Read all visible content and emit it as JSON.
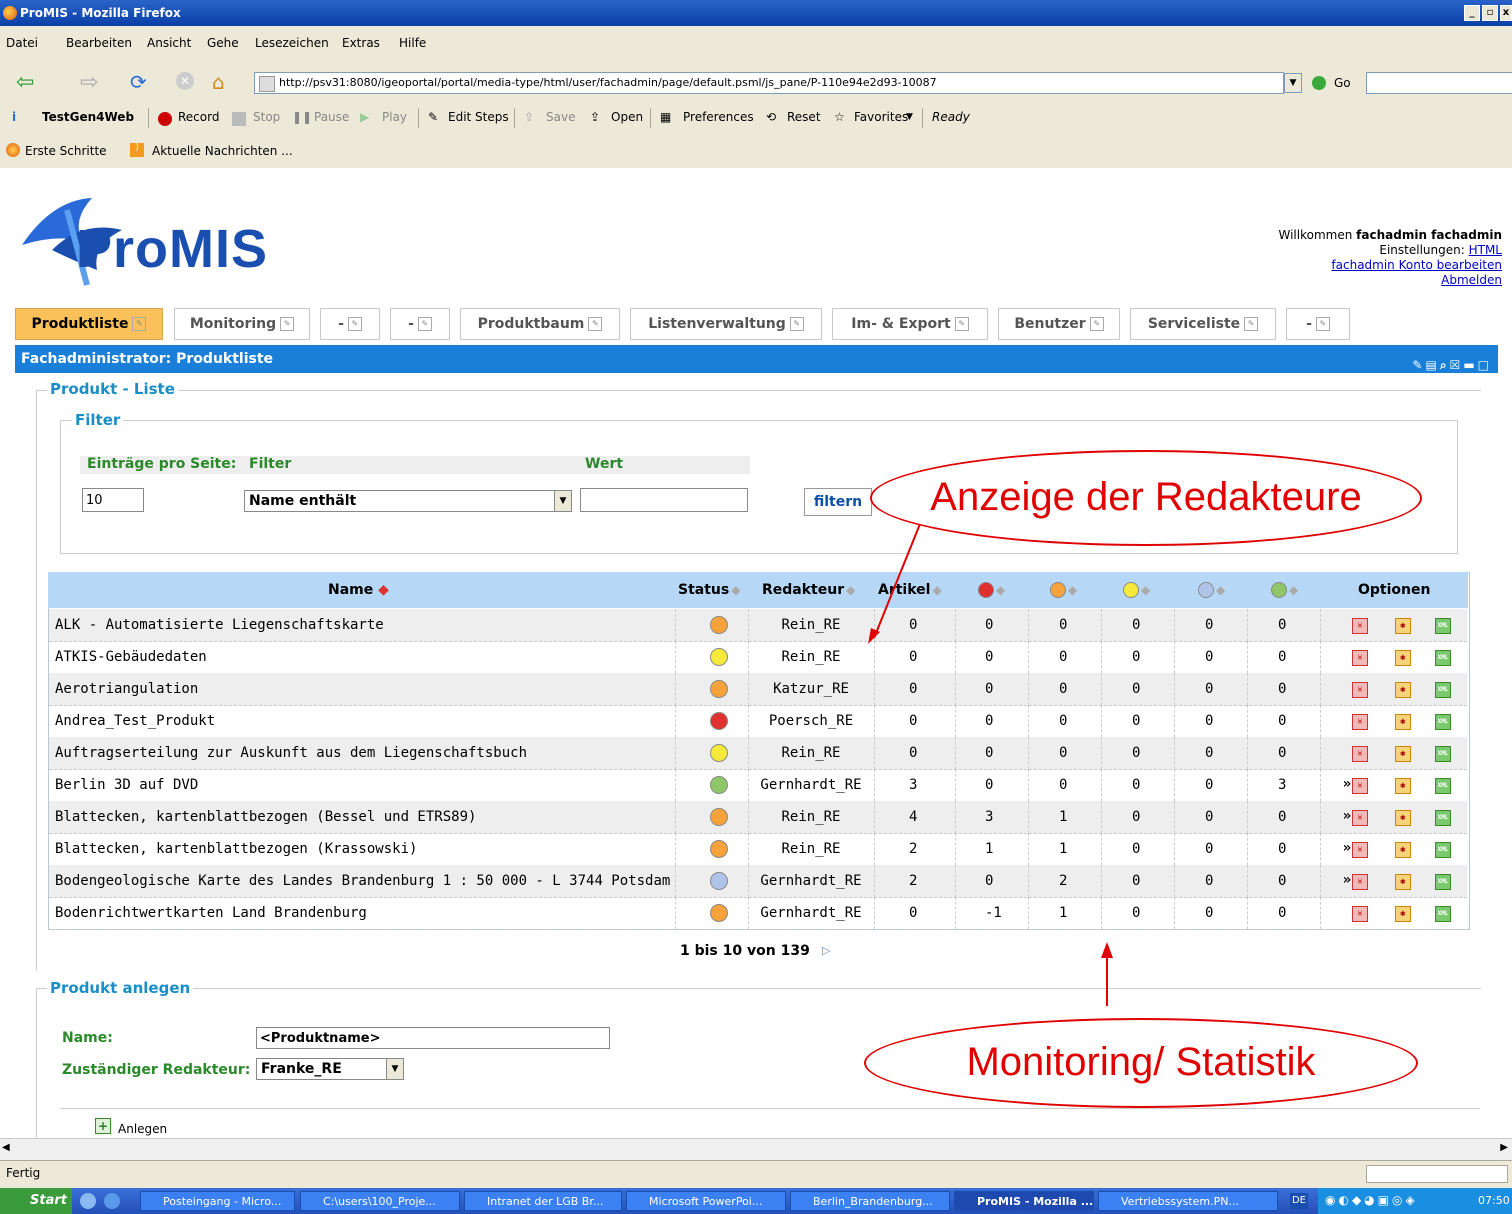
{
  "window": {
    "title": "ProMIS - Mozilla Firefox"
  },
  "menu": [
    "Datei",
    "Bearbeiten",
    "Ansicht",
    "Gehe",
    "Lesezeichen",
    "Extras",
    "Hilfe"
  ],
  "nav": {
    "url": "http://psv31:8080/igeoportal/portal/media-type/html/user/fachadmin/page/default.psml/js_pane/P-110e94e2d93-10087",
    "go_label": "Go"
  },
  "testgen": {
    "name": "TestGen4Web",
    "record": "Record",
    "stop": "Stop",
    "pause": "Pause",
    "play": "Play",
    "edit_steps": "Edit Steps",
    "save": "Save",
    "open": "Open",
    "preferences": "Preferences",
    "reset": "Reset",
    "favorites": "Favorites",
    "status": "Ready"
  },
  "bookmarks": [
    "Erste Schritte",
    "Aktuelle Nachrichten ..."
  ],
  "header": {
    "logo_text": "ProMIS",
    "welcome_prefix": "Willkommen",
    "welcome_user": "fachadmin fachadmin",
    "settings_prefix": "Einstellungen:",
    "settings_link": "HTML",
    "account_link": "fachadmin Konto bearbeiten",
    "logout_link": "Abmelden"
  },
  "tabs": [
    "Produktliste",
    "Monitoring",
    "-",
    "-",
    "Produktbaum",
    "Listenverwaltung",
    "Im- & Export",
    "Benutzer",
    "Serviceliste",
    "-"
  ],
  "panel": {
    "title": "Fachadministrator: Produktliste"
  },
  "list_section": {
    "legend": "Produkt - Liste"
  },
  "filter": {
    "legend": "Filter",
    "per_page_label": "Einträge pro Seite:",
    "filter_label": "Filter",
    "value_label": "Wert",
    "per_page_value": "10",
    "filter_selected": "Name enthält",
    "value_value": "",
    "button": "filtern"
  },
  "table": {
    "headers": {
      "name": "Name",
      "status": "Status",
      "editor": "Redakteur",
      "articles": "Artikel",
      "options": "Optionen"
    },
    "status_colors": {
      "red": "#e03030",
      "orange": "#f7a23a",
      "yellow": "#f5ea3a",
      "blue": "#b0c4ea",
      "green": "#8fc66a"
    },
    "rows": [
      {
        "name": "ALK - Automatisierte Liegenschaftskarte",
        "status": "orange",
        "editor": "Rein_RE",
        "articles": "0",
        "c1": "0",
        "c2": "0",
        "c3": "0",
        "c4": "0",
        "c5": "0",
        "arrow": false
      },
      {
        "name": "ATKIS-Gebäudedaten",
        "status": "yellow",
        "editor": "Rein_RE",
        "articles": "0",
        "c1": "0",
        "c2": "0",
        "c3": "0",
        "c4": "0",
        "c5": "0",
        "arrow": false
      },
      {
        "name": "Aerotriangulation",
        "status": "orange",
        "editor": "Katzur_RE",
        "articles": "0",
        "c1": "0",
        "c2": "0",
        "c3": "0",
        "c4": "0",
        "c5": "0",
        "arrow": false
      },
      {
        "name": "Andrea_Test_Produkt",
        "status": "red",
        "editor": "Poersch_RE",
        "articles": "0",
        "c1": "0",
        "c2": "0",
        "c3": "0",
        "c4": "0",
        "c5": "0",
        "arrow": false
      },
      {
        "name": "Auftragserteilung zur Auskunft aus dem Liegenschaftsbuch",
        "status": "yellow",
        "editor": "Rein_RE",
        "articles": "0",
        "c1": "0",
        "c2": "0",
        "c3": "0",
        "c4": "0",
        "c5": "0",
        "arrow": false
      },
      {
        "name": "Berlin 3D auf DVD",
        "status": "green",
        "editor": "Gernhardt_RE",
        "articles": "3",
        "c1": "0",
        "c2": "0",
        "c3": "0",
        "c4": "0",
        "c5": "3",
        "arrow": true
      },
      {
        "name": "Blattecken, kartenblattbezogen (Bessel und ETRS89)",
        "status": "orange",
        "editor": "Rein_RE",
        "articles": "4",
        "c1": "3",
        "c2": "1",
        "c3": "0",
        "c4": "0",
        "c5": "0",
        "arrow": true
      },
      {
        "name": "Blattecken, kartenblattbezogen (Krassowski)",
        "status": "orange",
        "editor": "Rein_RE",
        "articles": "2",
        "c1": "1",
        "c2": "1",
        "c3": "0",
        "c4": "0",
        "c5": "0",
        "arrow": true
      },
      {
        "name": "Bodengeologische Karte des Landes Brandenburg 1 : 50 000 - L 3744 Potsdam",
        "status": "blue",
        "editor": "Gernhardt_RE",
        "articles": "2",
        "c1": "0",
        "c2": "2",
        "c3": "0",
        "c4": "0",
        "c5": "0",
        "arrow": true
      },
      {
        "name": "Bodenrichtwertkarten Land Brandenburg",
        "status": "orange",
        "editor": "Gernhardt_RE",
        "articles": "0",
        "c1": "-1",
        "c2": "1",
        "c3": "0",
        "c4": "0",
        "c5": "0",
        "arrow": false
      }
    ],
    "pagination": "1 bis 10 von 139"
  },
  "create": {
    "legend": "Produkt anlegen",
    "name_label": "Name:",
    "name_value": "<Produktname>",
    "editor_label": "Zuständiger Redakteur:",
    "editor_value": "Franke_RE",
    "add_button": "Anlegen"
  },
  "annotations": {
    "editors": "Anzeige der Redakteure",
    "monitoring": "Monitoring/ Statistik"
  },
  "statusbar": {
    "text": "Fertig"
  },
  "taskbar": {
    "start": "Start",
    "tasks": [
      "Posteingang - Micro...",
      "C:\\users\\100_Proje...",
      "Intranet der LGB Br...",
      "Microsoft PowerPoi...",
      "Berlin_Brandenburg...",
      "ProMIS - Mozilla ...",
      "Vertriebssystem.PN..."
    ],
    "lang": "DE",
    "clock": "07:50"
  }
}
